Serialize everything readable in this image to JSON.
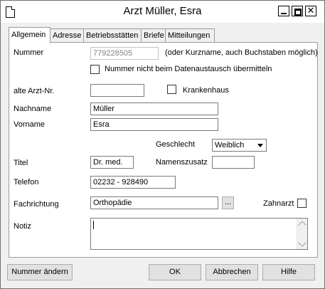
{
  "window": {
    "title": "Arzt Müller, Esra"
  },
  "tabs": [
    {
      "label": "Allgemein",
      "active": true
    },
    {
      "label": "Adresse",
      "active": false
    },
    {
      "label": "Betriebsstätten",
      "active": false
    },
    {
      "label": "Briefe",
      "active": false
    },
    {
      "label": "Mitteilungen",
      "active": false
    }
  ],
  "form": {
    "nummer_label": "Nummer",
    "nummer_value": "779228505",
    "nummer_hint": "(oder Kurzname, auch Buchstaben möglich)",
    "no_exchange_label": "Nummer nicht beim Datenaustausch übermitteln",
    "alte_nr_label": "alte Arzt-Nr.",
    "alte_nr_value": "",
    "krankenhaus_label": "Krankenhaus",
    "nachname_label": "Nachname",
    "nachname_value": "Müller",
    "vorname_label": "Vorname",
    "vorname_value": "Esra",
    "geschlecht_label": "Geschlecht",
    "geschlecht_value": "Weiblich",
    "titel_label": "Titel",
    "titel_value": "Dr. med.",
    "namenszusatz_label": "Namenszusatz",
    "namenszusatz_value": "",
    "telefon_label": "Telefon",
    "telefon_value": "02232 - 928490",
    "fachrichtung_label": "Fachrichtung",
    "fachrichtung_value": "Orthopädie",
    "browse_label": "...",
    "zahnarzt_label": "Zahnarzt",
    "notiz_label": "Notiz",
    "notiz_value": ""
  },
  "buttons": {
    "nummer_aendern": "Nummer ändern",
    "ok": "OK",
    "abbrechen": "Abbrechen",
    "hilfe": "Hilfe"
  },
  "icons": {
    "app": "document-icon",
    "minimize": "minimize-icon",
    "maximize": "maximize-icon",
    "close": "close-icon"
  }
}
